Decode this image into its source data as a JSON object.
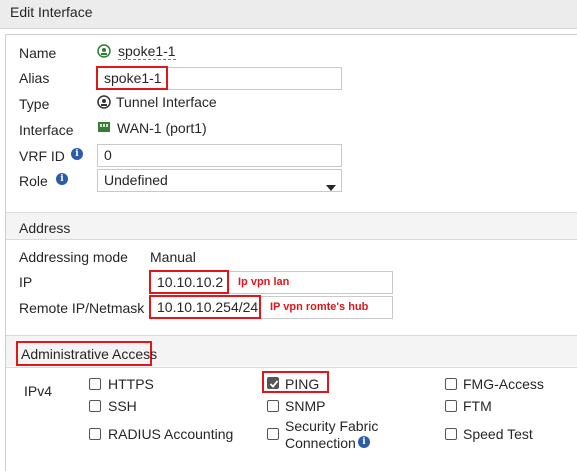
{
  "dialog": {
    "title": "Edit Interface"
  },
  "general": {
    "name": {
      "label": "Name",
      "value": "spoke1-1",
      "icon": "tunnel-icon"
    },
    "alias": {
      "label": "Alias",
      "value": "spoke1-1"
    },
    "type": {
      "label": "Type",
      "value": "Tunnel Interface",
      "icon": "tunnel-icon"
    },
    "interface": {
      "label": "Interface",
      "value": "WAN-1 (port1)",
      "icon": "port-icon"
    },
    "vrf_id": {
      "label": "VRF ID",
      "value": "0"
    },
    "role": {
      "label": "Role",
      "value": "Undefined"
    }
  },
  "address": {
    "section_title": "Address",
    "addressing_mode": {
      "label": "Addressing mode",
      "value": "Manual"
    },
    "ip": {
      "label": "IP",
      "value": "10.10.10.2",
      "annotation": "Ip vpn lan"
    },
    "remote": {
      "label": "Remote IP/Netmask",
      "value": "10.10.10.254/24",
      "annotation": "IP vpn romte's hub"
    }
  },
  "admin_access": {
    "section_title": "Administrative Access",
    "ipv4_label": "IPv4",
    "options": {
      "https": {
        "label": "HTTPS",
        "checked": false
      },
      "ping": {
        "label": "PING",
        "checked": true
      },
      "fmg_access": {
        "label": "FMG-Access",
        "checked": false
      },
      "ssh": {
        "label": "SSH",
        "checked": false
      },
      "snmp": {
        "label": "SNMP",
        "checked": false
      },
      "ftm": {
        "label": "FTM",
        "checked": false
      },
      "radius": {
        "label": "RADIUS Accounting",
        "checked": false
      },
      "security_fabric_line1": "Security Fabric",
      "security_fabric_line2": "Connection",
      "speed_test": {
        "label": "Speed Test",
        "checked": false
      }
    }
  },
  "colors": {
    "highlight": "#e0161a",
    "info": "#2a5caa",
    "header_bg": "#ececec"
  }
}
